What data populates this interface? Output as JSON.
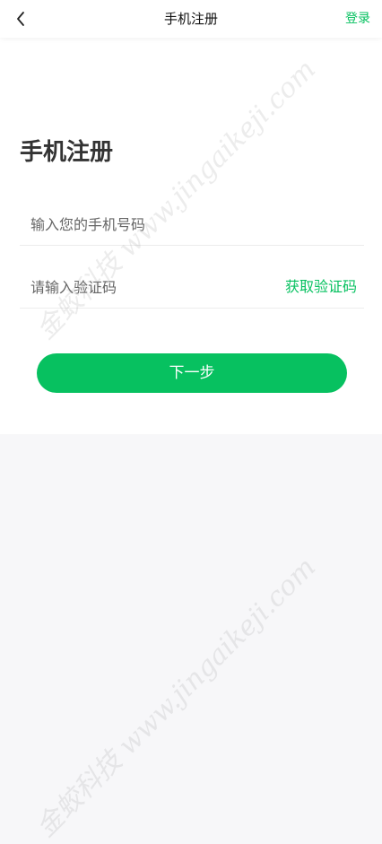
{
  "navbar": {
    "title": "手机注册",
    "login_label": "登录",
    "back_icon": "chevron-left-icon"
  },
  "main": {
    "heading": "手机注册",
    "phone_placeholder": "输入您的手机号码",
    "code_placeholder": "请输入验证码",
    "get_code_label": "获取验证码",
    "next_label": "下一步"
  },
  "watermark": {
    "text": "金蛟科技 www.jingaikeji.com"
  },
  "colors": {
    "accent": "#07c160",
    "page_bg": "#f7f7f9",
    "card_bg": "#ffffff"
  }
}
